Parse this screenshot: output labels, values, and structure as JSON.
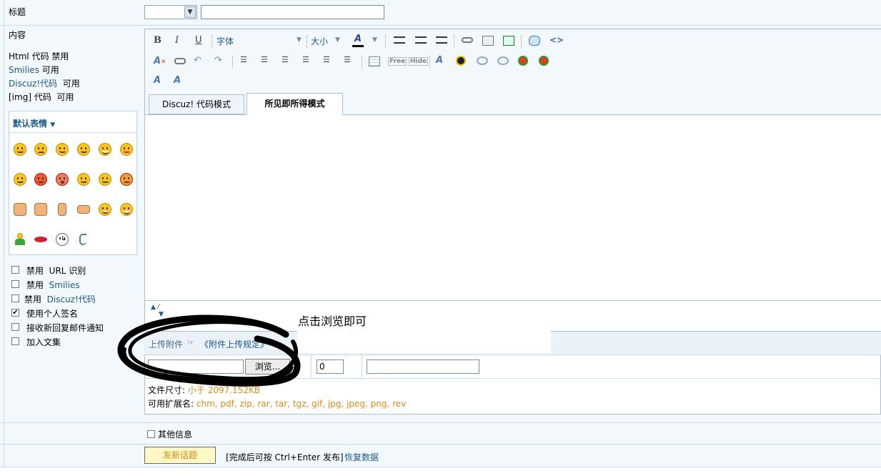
{
  "title_row": {
    "label": "标题",
    "select_value": "",
    "input_value": ""
  },
  "content": {
    "label": "内容",
    "rules": [
      {
        "name": "Html 代码",
        "status": "禁用"
      },
      {
        "name": "Smilies",
        "status": "可用"
      },
      {
        "name": "Discuz!代码",
        "status": "可用"
      },
      {
        "name": "[img] 代码",
        "status": "可用"
      }
    ],
    "smiley_panel_title": "默认表情",
    "smiley_icons": [
      "smile-icon",
      "sad-icon",
      "grin-icon",
      "happy-icon",
      "laugh-icon",
      "tongue-icon",
      "shy-icon",
      "angry-icon",
      "shock-icon",
      "cry-icon",
      "confused-icon",
      "love-icon",
      "thumbs-left-icon",
      "thumbs-down-icon",
      "victory-icon",
      "handshake-icon",
      "frustrated-icon",
      "big-smile-icon",
      "person-icon",
      "lips-icon",
      "clock-icon",
      "phone-icon"
    ],
    "options": [
      {
        "label_a": "禁用",
        "label_b": "URL 识别",
        "checked": false
      },
      {
        "label_a": "禁用",
        "label_b": "Smilies",
        "checked": false
      },
      {
        "label_a": "禁用",
        "label_b": "Discuz!代码",
        "checked": false
      },
      {
        "label_a": "使用个人签名",
        "label_b": "",
        "checked": true
      },
      {
        "label_a": "接收新回复邮件通知",
        "label_b": "",
        "checked": false
      },
      {
        "label_a": "加入文集",
        "label_b": "",
        "checked": false
      }
    ]
  },
  "toolbar": {
    "bold": "B",
    "italic": "I",
    "underline": "U",
    "font_label": "字体",
    "size_label": "大小",
    "color_label": "A",
    "free_label": "Free",
    "hide_label": "Hide"
  },
  "tabs": {
    "discuz_mode": "Discuz! 代码模式",
    "wysiwyg_mode": "所见即所得模式"
  },
  "upload": {
    "label": "上传附件",
    "rules_link": "《附件上传规定》",
    "browse_button": "浏览...",
    "count_value": "0",
    "size_label": "文件尺寸:",
    "size_value": "小于 2097.152KB",
    "ext_label": "可用扩展名:",
    "ext_value": "chm, pdf, zip, rar, tar, tgz, gif, jpg, jpeg, png, rev"
  },
  "annotation": {
    "text": "点击浏览即可"
  },
  "other_info": {
    "label": "其他信息",
    "checked": false
  },
  "submit": {
    "button": "发新话题",
    "hint": "[完成后可按 Ctrl+Enter 发布]",
    "restore_link": "恢复数据"
  },
  "colors": {
    "row_bg": "#f3f8fc",
    "border": "#a9bfd3",
    "link": "#1b5a8a",
    "orange": "#e08a18",
    "submit_bg": "#fff8c4"
  }
}
